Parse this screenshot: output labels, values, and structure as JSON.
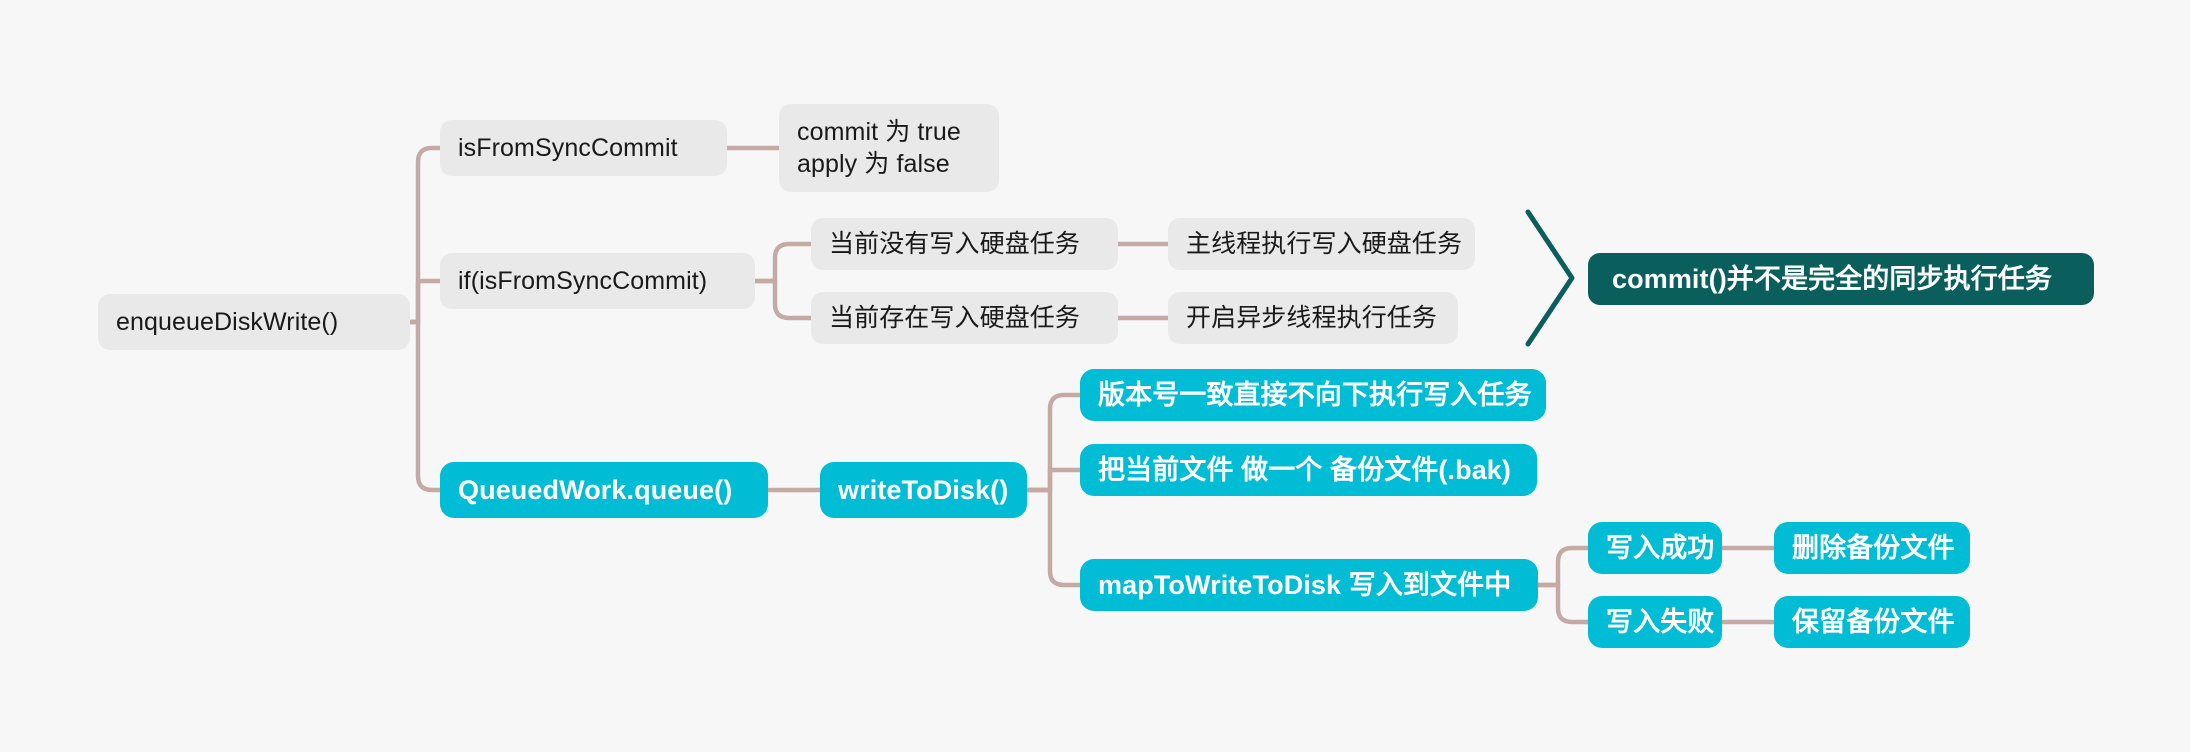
{
  "diagram": {
    "type": "mindmap",
    "background_color": "#f7f7f8",
    "edge_color": "#c4a9a4",
    "palette": {
      "grey_node_bg": "#e9e9e9",
      "grey_node_text": "#191919",
      "cyan_node_bg": "#00bcd4",
      "cyan_node_text": "#ffffff",
      "teal_node_bg": "#0a5f5c",
      "teal_node_text": "#ffffff",
      "chevron_color": "#0a5f5c"
    },
    "root": {
      "label": "enqueueDiskWrite()"
    },
    "nodes": {
      "is_from_sync_commit": "isFromSyncCommit",
      "commit_apply_flags_line1": "commit 为 true",
      "commit_apply_flags_line2": "apply 为 false",
      "if_is_from_sync_commit": "if(isFromSyncCommit)",
      "no_pending_disk_task": "当前没有写入硬盘任务",
      "main_thread_executes": "主线程执行写入硬盘任务",
      "has_pending_disk_task": "当前存在写入硬盘任务",
      "start_async_thread": "开启异步线程执行任务",
      "conclusion": "commit()并不是完全的同步执行任务",
      "queued_work_queue": "QueuedWork.queue()",
      "write_to_disk": "writeToDisk()",
      "version_match_skip": "版本号一致直接不向下执行写入任务",
      "make_backup_file": "把当前文件 做一个 备份文件(.bak)",
      "map_to_write_to_disk": "mapToWriteToDisk 写入到文件中",
      "write_success": "写入成功",
      "delete_backup_file": "删除备份文件",
      "write_failure": "写入失败",
      "keep_backup_file": "保留备份文件"
    }
  }
}
